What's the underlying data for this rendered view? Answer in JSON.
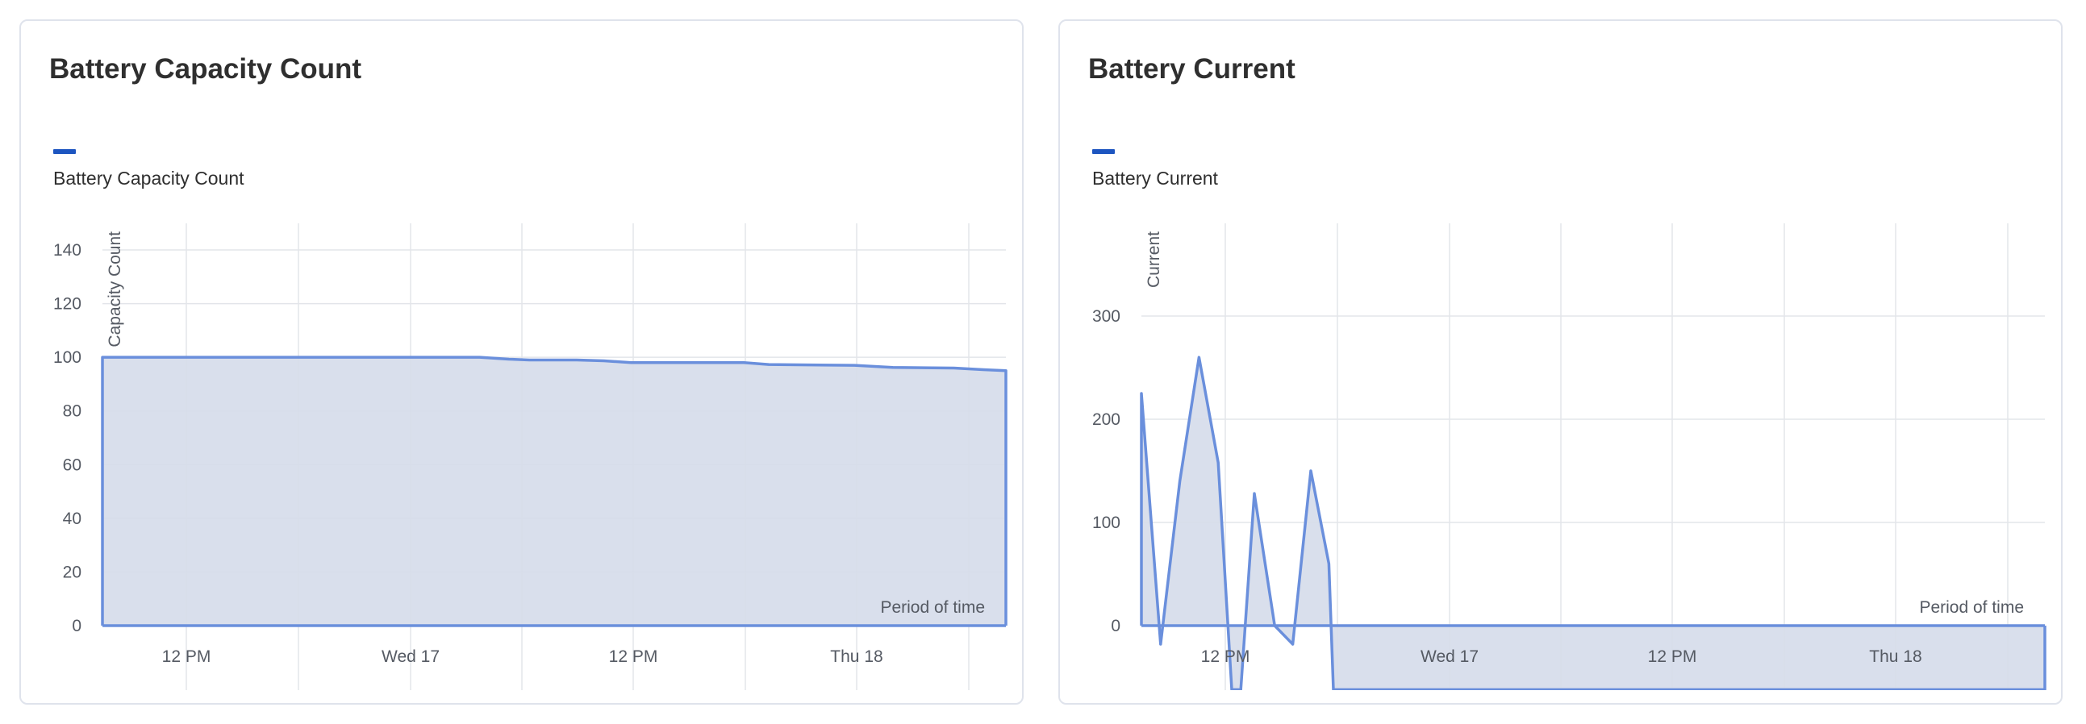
{
  "colors": {
    "line": "#6a8fdc",
    "area": "#d5dcea",
    "legend": "#1d55c0",
    "grid": "#e3e5ea",
    "axis": "#555a63"
  },
  "chart_data": [
    {
      "type": "area",
      "title": "Battery Capacity Count",
      "legend": [
        "Battery Capacity Count"
      ],
      "xlabel": "Period of time",
      "ylabel": "Capacity Count",
      "x_ticks": [
        "12 PM",
        "Wed 17",
        "12 PM",
        "Thu 18"
      ],
      "y_ticks": [
        0,
        20,
        40,
        60,
        80,
        100,
        120,
        140
      ],
      "ylim": [
        0,
        150
      ],
      "xlim": [
        0,
        40
      ],
      "grid": true,
      "legend_position": "top-left",
      "series": [
        {
          "name": "Battery Capacity Count",
          "x": [
            0,
            5,
            10,
            15,
            16.7,
            18,
            18.9,
            21,
            22.2,
            23.4,
            28.4,
            29.5,
            33.3,
            35,
            37.7,
            39,
            40
          ],
          "y": [
            100,
            100,
            100,
            100,
            100,
            99.3,
            99,
            99,
            98.7,
            98,
            98,
            97.3,
            97,
            96.2,
            96,
            95.4,
            95
          ]
        }
      ]
    },
    {
      "type": "area",
      "title": "Battery Current",
      "legend": [
        "Battery Current"
      ],
      "xlabel": "Period of time",
      "ylabel": "Current",
      "x_ticks": [
        "12 PM",
        "Wed 17",
        "12 PM",
        "Thu 18"
      ],
      "y_ticks": [
        0,
        100,
        200,
        300
      ],
      "ylim": [
        -62,
        390
      ],
      "xlim": [
        0,
        40
      ],
      "grid": true,
      "legend_position": "top-left",
      "series": [
        {
          "name": "Battery Current",
          "x": [
            0,
            0.85,
            1.7,
            2.55,
            3.4,
            4.0,
            4.4,
            5.0,
            5.9,
            6.7,
            7.5,
            8.3,
            8.5,
            40
          ],
          "y": [
            225,
            -18,
            140,
            260,
            158,
            -62,
            -62,
            128,
            0,
            -18,
            150,
            60,
            -62,
            -62
          ]
        }
      ]
    }
  ]
}
